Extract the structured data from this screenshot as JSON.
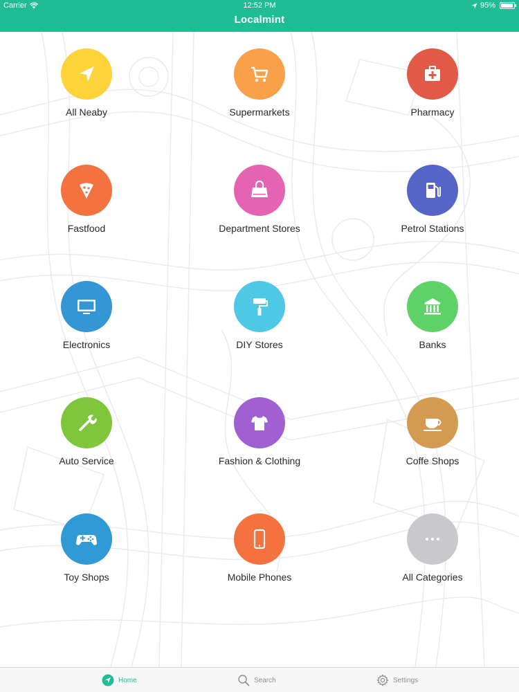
{
  "status_bar": {
    "carrier": "Carrier",
    "time": "12:52 PM",
    "battery": "95%",
    "battery_level": 0.95
  },
  "header": {
    "title": "Localmint"
  },
  "categories": [
    {
      "label": "All Neaby",
      "icon": "location-arrow-icon",
      "color": "#fcd43a"
    },
    {
      "label": "Supermarkets",
      "icon": "shopping-cart-icon",
      "color": "#f9a04a"
    },
    {
      "label": "Pharmacy",
      "icon": "first-aid-kit-icon",
      "color": "#e05a47"
    },
    {
      "label": "Fastfood",
      "icon": "pizza-slice-icon",
      "color": "#f47140"
    },
    {
      "label": "Department Stores",
      "icon": "shopping-bag-icon",
      "color": "#e463b2"
    },
    {
      "label": "Petrol Stations",
      "icon": "fuel-pump-icon",
      "color": "#5566c8"
    },
    {
      "label": "Electronics",
      "icon": "tv-icon",
      "color": "#3496d4"
    },
    {
      "label": "DIY Stores",
      "icon": "paint-roller-icon",
      "color": "#4ec8e4"
    },
    {
      "label": "Banks",
      "icon": "bank-building-icon",
      "color": "#5ed168"
    },
    {
      "label": "Auto Service",
      "icon": "wrench-icon",
      "color": "#80c63c"
    },
    {
      "label": "Fashion & Clothing",
      "icon": "tshirt-icon",
      "color": "#a160d2"
    },
    {
      "label": "Coffe Shops",
      "icon": "coffee-cup-icon",
      "color": "#d39a52"
    },
    {
      "label": "Toy Shops",
      "icon": "gamepad-icon",
      "color": "#2f9ad6"
    },
    {
      "label": "Mobile Phones",
      "icon": "mobile-phone-icon",
      "color": "#f47140"
    },
    {
      "label": "All Categories",
      "icon": "more-dots-icon",
      "color": "#c9c8cd"
    }
  ],
  "tabbar": {
    "home": "Home",
    "search": "Search",
    "settings": "Settings",
    "active_color": "#1fbc95"
  }
}
